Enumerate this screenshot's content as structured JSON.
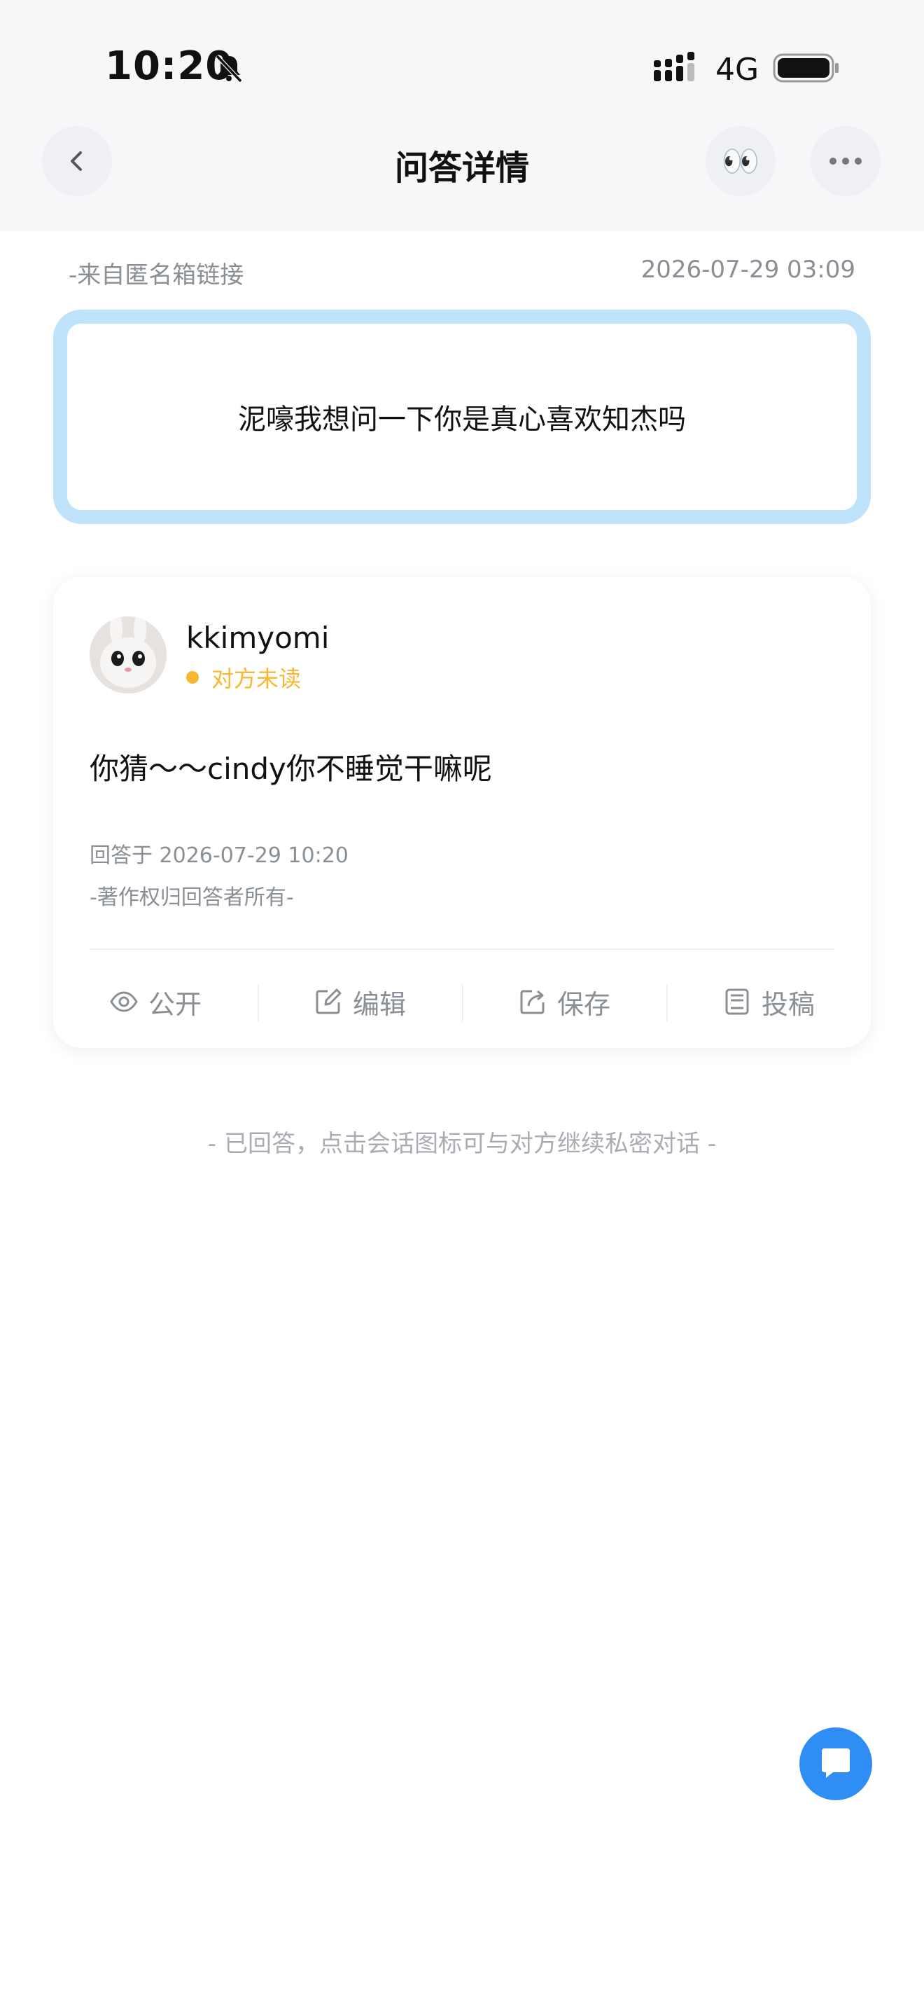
{
  "status_bar": {
    "time": "10:20",
    "network": "4G"
  },
  "nav": {
    "title": "问答详情",
    "emoji": "👀"
  },
  "question": {
    "source": "-来自匿名箱链接",
    "time": "2026-07-29 03:09",
    "text": "泥嚎我想问一下你是真心喜欢知杰吗"
  },
  "answer": {
    "username": "kkimyomi",
    "read_status": "对方未读",
    "text": "你猜～～cindy你不睡觉干嘛呢",
    "answered_time": "回答于 2026-07-29 10:20",
    "copyright": "-著作权归回答者所有-"
  },
  "actions": [
    {
      "label": "公开",
      "icon": "eye-icon"
    },
    {
      "label": "编辑",
      "icon": "edit-icon"
    },
    {
      "label": "保存",
      "icon": "share-icon"
    },
    {
      "label": "投稿",
      "icon": "document-icon"
    }
  ],
  "hint": "- 已回答，点击会话图标可与对方继续私密对话 -",
  "colors": {
    "accent_blue": "#2f8ef4",
    "question_border": "#bfe3fb",
    "unread": "#f7b733"
  }
}
